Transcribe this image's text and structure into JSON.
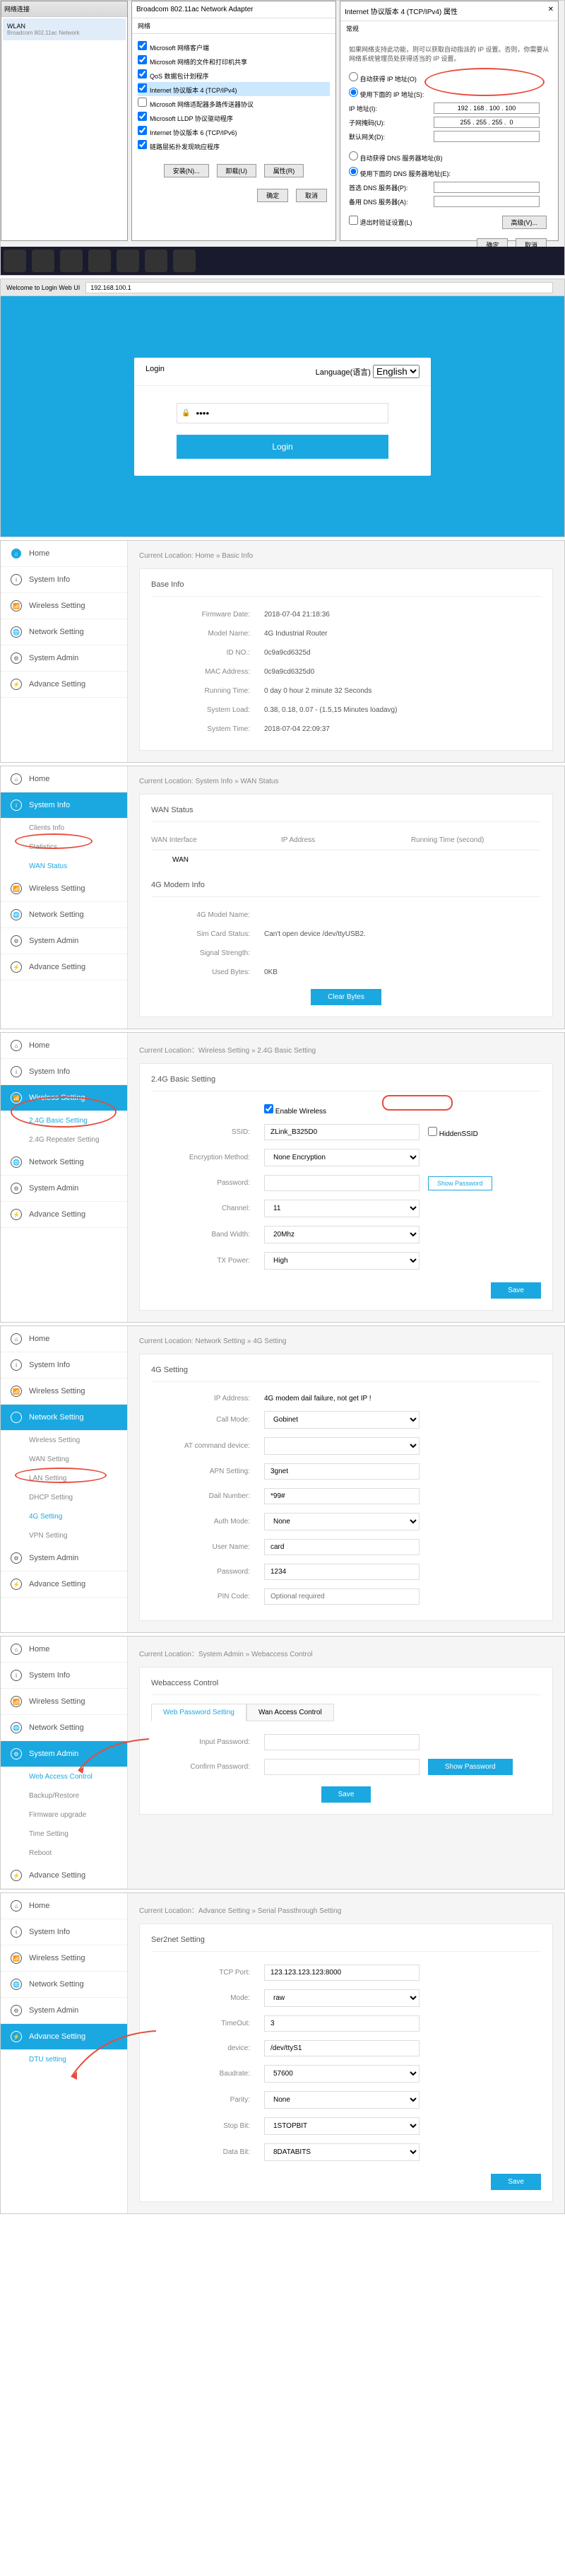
{
  "windows": {
    "left_panel_title": "网络连接",
    "wlan_label": "WLAN",
    "wlan_sub": "Broadcom 802.11ac Network",
    "adapter_title": "Broadcom 802.11ac Network Adapter",
    "net_tab": "网络",
    "checks": [
      "Microsoft 网络客户端",
      "Microsoft 网络的文件和打印机共享",
      "QoS 数据包计划程序",
      "Internet 协议版本 4 (TCP/IPv4)",
      "Microsoft 网络适配器多路传送器协议",
      "Microsoft LLDP 协议驱动程序",
      "Internet 协议版本 6 (TCP/IPv6)",
      "链路层拓扑发现响应程序"
    ],
    "install_btn": "安装(N)...",
    "uninstall_btn": "卸载(U)",
    "props_btn": "属性(R)",
    "ipv4_title": "Internet 协议版本 4 (TCP/IPv4) 属性",
    "tab_general": "常规",
    "ipv4_desc": "如果网络支持此功能，则可以获取自动指派的 IP 设置。否则，你需要从网络系统管理员处获得适当的 IP 设置。",
    "radio_auto": "自动获得 IP 地址(O)",
    "radio_manual": "使用下面的 IP 地址(S):",
    "ip_label": "IP 地址(I):",
    "ip_value": "192 . 168 . 100 . 100",
    "mask_label": "子网掩码(U):",
    "mask_value": "255 . 255 . 255 .  0",
    "gw_label": "默认网关(D):",
    "dns_auto": "自动获得 DNS 服务器地址(B)",
    "dns_manual": "使用下面的 DNS 服务器地址(E):",
    "dns1_label": "首选 DNS 服务器(P):",
    "dns2_label": "备用 DNS 服务器(A):",
    "exit_validate": "退出时验证设置(L)",
    "advanced_btn": "高级(V)...",
    "ok": "确定",
    "cancel": "取消"
  },
  "browser": {
    "title": "Welcome to Login Web UI",
    "url": "192.168.100.1"
  },
  "login": {
    "title": "Login",
    "lang_label": "Language(语言)",
    "lang_value": "English",
    "password_placeholder": "••••",
    "button": "Login"
  },
  "nav": {
    "home": "Home",
    "system_info": "System Info",
    "wireless": "Wireless Setting",
    "network": "Network Setting",
    "admin": "System Admin",
    "advance": "Advance Setting"
  },
  "basic": {
    "breadcrumb": "Current Location: Home » Basic Info",
    "panel": "Base Info",
    "rows": {
      "fw_l": "Firmware Date:",
      "fw_v": "2018-07-04 21:18:36",
      "model_l": "Model Name:",
      "model_v": "4G Industrial Router",
      "id_l": "ID NO.:",
      "id_v": "0c9a9cd6325d",
      "mac_l": "MAC Address:",
      "mac_v": "0c9a9cd6325d0",
      "run_l": "Running Time:",
      "run_v": "0 day 0 hour 2 minute 32 Seconds",
      "load_l": "System Load:",
      "load_v": "0.38, 0.18, 0.07 - (1.5,15 Minutes loadavg)",
      "time_l": "System Time:",
      "time_v": "2018-07-04 22:09:37"
    }
  },
  "wan": {
    "breadcrumb": "Current Location: System Info » WAN Status",
    "panel": "WAN Status",
    "subs": {
      "clients": "Clients Info",
      "stats": "Statistics",
      "wan": "WAN Status"
    },
    "cols": {
      "iface": "WAN Interface",
      "ip": "IP Address",
      "runtime": "Running Time (second)"
    },
    "wan_row": "WAN",
    "modem_title": "4G Modem Info",
    "rows": {
      "name_l": "4G Model Name:",
      "sim_l": "Sim Card Status:",
      "sim_v": "Can't open device /dev/ttyUSB2.",
      "sig_l": "Signal Strength:",
      "bytes_l": "Used Bytes:",
      "bytes_v": "0KB"
    },
    "clear_btn": "Clear Bytes"
  },
  "wifi": {
    "breadcrumb": "Current Location：Wireless Setting » 2.4G Basic Setting",
    "panel": "2.4G Basic Setting",
    "subs": {
      "basic": "2.4G Basic Setting",
      "repeater": "2.4G Repeater Setting"
    },
    "enable": "Enable Wireless",
    "ssid_l": "SSID:",
    "ssid_v": "ZLink_B325D0",
    "hide": "HiddenSSID",
    "enc_l": "Encryption Method:",
    "enc_v": "None Encryption",
    "pwd_l": "Password:",
    "show_pwd": "Show Password",
    "ch_l": "Channel:",
    "ch_v": "11",
    "bw_l": "Band Width:",
    "bw_v": "20Mhz",
    "tx_l": "TX Power:",
    "tx_v": "High",
    "save": "Save"
  },
  "net4g": {
    "breadcrumb": "Current Location: Network Setting » 4G Setting",
    "panel": "4G Setting",
    "subs": {
      "wireless": "Wireless Setting",
      "wan": "WAN Setting",
      "lan": "LAN Setting",
      "dhcp": "DHCP Setting",
      "g4": "4G Setting",
      "vpn": "VPN Setting"
    },
    "ip_l": "IP Address:",
    "ip_v": "4G modem dail failure, not get IP !",
    "call_l": "Call Mode:",
    "call_v": "Gobinet",
    "at_l": "AT command device:",
    "apn_l": "APN Setting:",
    "apn_v": "3gnet",
    "dial_l": "Dail Number:",
    "dial_v": "*99#",
    "auth_l": "Auth Mode:",
    "auth_v": "None",
    "user_l": "User Name:",
    "user_v": "card",
    "pwd_l": "Password:",
    "pwd_v": "1234",
    "pin_l": "PIN Code:",
    "pin_ph": "Optional required"
  },
  "webaccess": {
    "breadcrumb": "Current Location：System Admin » Webaccess Control",
    "panel": "Webaccess Control",
    "tabs": {
      "pwd": "Web Password Setting",
      "wan": "Wan Access Control"
    },
    "subs": {
      "web": "Web Access Control",
      "backup": "Backup/Restore",
      "fw": "Firmware upgrade",
      "time": "Time Setting",
      "reboot": "Reboot"
    },
    "input_l": "Input Password:",
    "confirm_l": "Confirm Password:",
    "show": "Show Password",
    "save": "Save"
  },
  "serial": {
    "breadcrumb": "Current Location：Advance Setting » Serial Passthrough Setting",
    "panel": "Ser2net Setting",
    "sub": "DTU setting",
    "tcp_l": "TCP Port:",
    "tcp_v": "123.123.123.123:8000",
    "mode_l": "Mode:",
    "mode_v": "raw",
    "timeout_l": "TimeOut:",
    "timeout_v": "3",
    "dev_l": "device:",
    "dev_v": "/dev/ttyS1",
    "baud_l": "Baudrate:",
    "baud_v": "57600",
    "parity_l": "Parity:",
    "parity_v": "None",
    "stop_l": "Stop Bit:",
    "stop_v": "1STOPBIT",
    "data_l": "Data Bit:",
    "data_v": "8DATABITS",
    "save": "Save"
  }
}
